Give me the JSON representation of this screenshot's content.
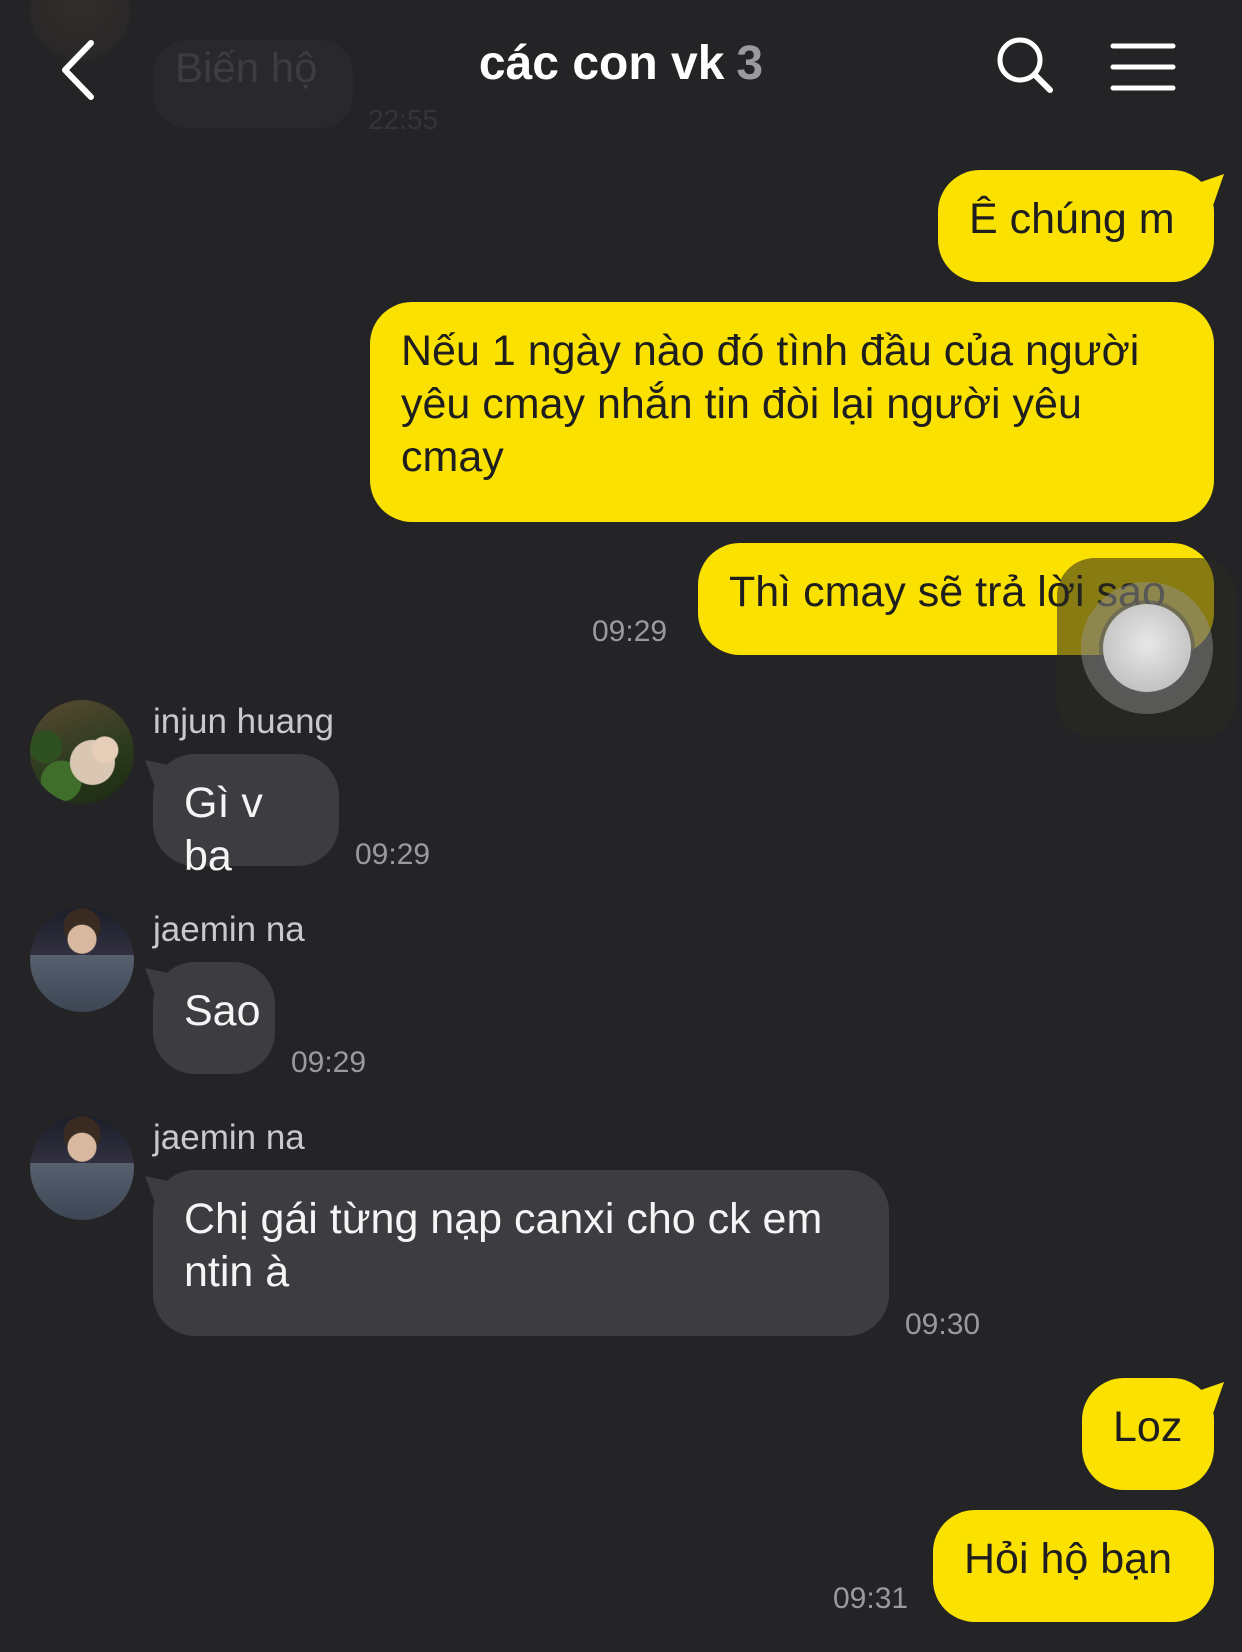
{
  "header": {
    "title": "các con vk",
    "member_count": "3",
    "icons": [
      "back-arrow-icon",
      "search-icon",
      "menu-icon"
    ]
  },
  "ghost_message": {
    "text": "Biến hộ",
    "time": "22:55"
  },
  "messages": [
    {
      "from": "me",
      "text": "Ê chúng m"
    },
    {
      "from": "me",
      "text": "Nếu 1 ngày nào đó tình đầu của người yêu cmay nhắn tin đòi lại người yêu cmay"
    },
    {
      "from": "me",
      "text": "Thì cmay sẽ trả lời sao",
      "time": "09:29"
    },
    {
      "from": "injun huang",
      "sender": "injun huang",
      "text": "Gì v ba",
      "time": "09:29"
    },
    {
      "from": "jaemin na",
      "sender": "jaemin na",
      "text": "Sao",
      "time": "09:29"
    },
    {
      "from": "jaemin na",
      "sender": "jaemin na",
      "text": "Chị gái từng nạp canxi cho ck em ntin à",
      "time": "09:30"
    },
    {
      "from": "me",
      "text": "Loz"
    },
    {
      "from": "me",
      "text": "Hỏi hộ bạn",
      "time": "09:31"
    }
  ],
  "colors": {
    "background": "#242427",
    "my_bubble": "#fae100",
    "other_bubble": "#3d3d41"
  }
}
